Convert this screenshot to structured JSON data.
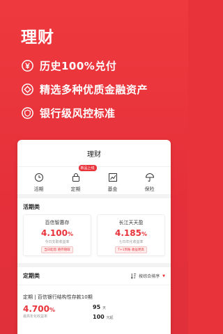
{
  "hero": {
    "title": "理财",
    "features": [
      {
        "icon": "yuan-icon",
        "text": "历史100%兑付"
      },
      {
        "icon": "diamond-icon",
        "text": "精选多种优质金融资产"
      },
      {
        "icon": "shield-icon",
        "text": "银行级风控标准"
      }
    ]
  },
  "app": {
    "title": "理财",
    "categories": [
      {
        "icon": "clock-icon",
        "label": "活期"
      },
      {
        "icon": "lock-icon",
        "label": "定期",
        "badge": "新品上线"
      },
      {
        "icon": "chart-icon",
        "label": "基金"
      },
      {
        "icon": "umbrella-icon",
        "label": "保险"
      }
    ],
    "current": {
      "title": "活期类",
      "cards": [
        {
          "name": "百信智惠存",
          "rate": "4.100",
          "unit": "%",
          "desc": "今日支取收益率",
          "tag": "当日起息 随存随取"
        },
        {
          "name": "长江天天盈",
          "rate": "4.185",
          "unit": "%",
          "desc": "七日年化收益率",
          "tag": "T+1到账 收益更高"
        }
      ]
    },
    "fixed": {
      "title": "定期类",
      "sort_label": "按综合排序",
      "product": {
        "name": "定期 | 百信银行结构性存款10期",
        "rate": "4.700",
        "unit": "%",
        "sub": "最高年化收益率",
        "days": "95",
        "days_unit": "天",
        "min": "100",
        "min_unit": "元起"
      }
    }
  },
  "colors": {
    "accent": "#e8333a"
  }
}
